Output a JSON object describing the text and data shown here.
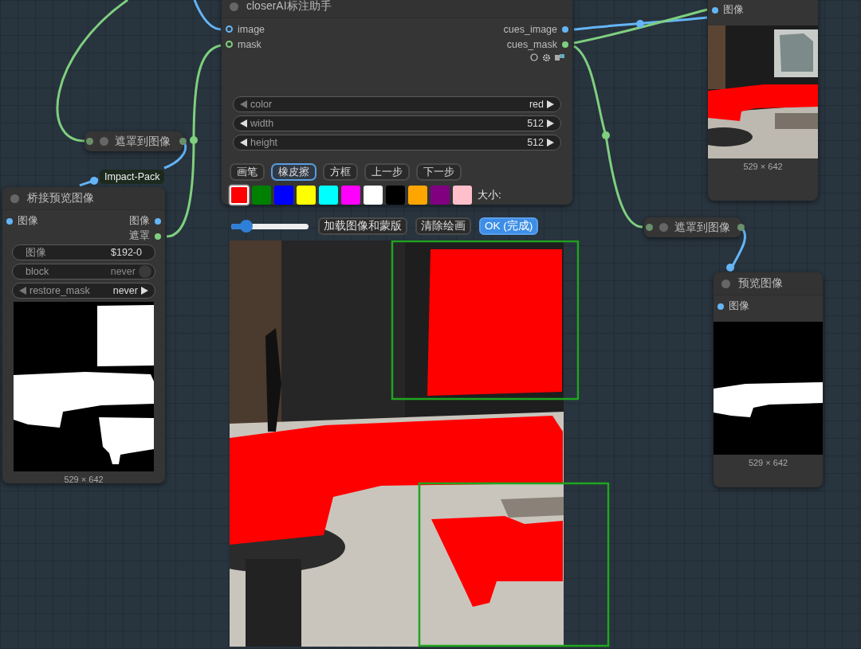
{
  "nodes": [
    {
      "kind": "annotator",
      "title": "closerAI标注助手",
      "inputs": [
        {
          "label": "image",
          "kind": "image"
        },
        {
          "label": "mask",
          "kind": "mask"
        }
      ],
      "outputs": [
        {
          "label": "cues_image",
          "kind": "image"
        },
        {
          "label": "cues_mask",
          "kind": "mask"
        }
      ],
      "widgets": [
        {
          "kind": "combo",
          "label": "color",
          "value": "red"
        },
        {
          "kind": "number",
          "label": "width",
          "value": "512"
        },
        {
          "kind": "number",
          "label": "height",
          "value": "512"
        }
      ],
      "tools": [
        {
          "label": "画笔",
          "selected": false
        },
        {
          "label": "橡皮擦",
          "selected": true
        },
        {
          "label": "方框",
          "selected": false
        },
        {
          "label": "上一步",
          "selected": false
        },
        {
          "label": "下一步",
          "selected": false
        }
      ],
      "swatches": [
        {
          "color": "#ff0000",
          "selected": true
        },
        {
          "color": "#008000",
          "selected": false
        },
        {
          "color": "#0000ff",
          "selected": false
        },
        {
          "color": "#ffff00",
          "selected": false
        },
        {
          "color": "#00ffff",
          "selected": false
        },
        {
          "color": "#ff00ff",
          "selected": false
        },
        {
          "color": "#ffffff",
          "selected": false
        },
        {
          "color": "#000000",
          "selected": false
        },
        {
          "color": "#ffa500",
          "selected": false
        },
        {
          "color": "#800080",
          "selected": false
        },
        {
          "color": "#ffc0cb",
          "selected": false
        }
      ],
      "size_label": "大小:",
      "slider": {
        "level": 0.2
      },
      "actions": [
        {
          "label": "加载图像和蒙版",
          "primary": false
        },
        {
          "label": "清除绘画",
          "primary": false
        },
        {
          "label": "OK (完成)",
          "primary": true
        }
      ]
    },
    {
      "kind": "collapsed",
      "title": "遮罩到图像"
    },
    {
      "kind": "bridge",
      "title": "桥接预览图像",
      "badge": "Impact-Pack",
      "inputs": [
        {
          "label": "图像",
          "kind": "image"
        }
      ],
      "outputs": [
        {
          "label": "图像",
          "kind": "image"
        },
        {
          "label": "遮罩",
          "kind": "mask"
        }
      ],
      "widgets": [
        {
          "kind": "text",
          "label": "图像",
          "value": "$192-0"
        },
        {
          "kind": "toggle",
          "label": "block",
          "value": "never",
          "on": false
        },
        {
          "kind": "combo",
          "label": "restore_mask",
          "value": "never"
        }
      ],
      "footer": "529 × 642"
    },
    {
      "kind": "preview",
      "inputs": [
        {
          "label": "图像",
          "kind": "image"
        }
      ],
      "footer": "529 × 642"
    },
    {
      "kind": "collapsed",
      "title": "遮罩到图像"
    },
    {
      "kind": "preview",
      "title": "预览图像",
      "inputs": [
        {
          "label": "图像",
          "kind": "image"
        }
      ],
      "footer": "529 × 642"
    }
  ]
}
